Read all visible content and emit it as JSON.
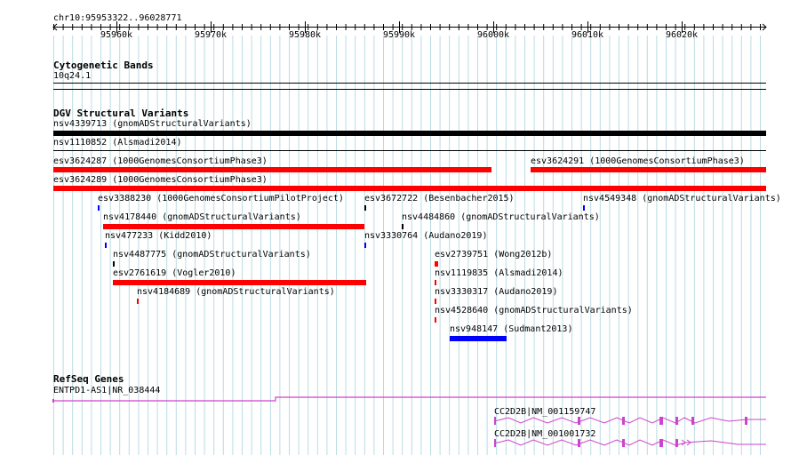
{
  "locus": "chr10:95953322..96028771",
  "ruler": {
    "ticks": [
      "95960k",
      "95970k",
      "95980k",
      "95990k",
      "96000k",
      "96010k",
      "96020k"
    ]
  },
  "colors": {
    "gridline": "#b9dce3",
    "gain": "#ff0000",
    "complex": "#000000",
    "loss": "#0000ff",
    "gene": "#cc44cc"
  },
  "tracks": {
    "cytoband": {
      "title": "Cytogenetic Bands",
      "band": "10q24.1"
    },
    "dgv": {
      "title": "DGV Structural Variants",
      "labels": {
        "nsv4339713": "nsv4339713 (gnomADStructuralVariants)",
        "nsv1110852": "nsv1110852 (Alsmadi2014)",
        "esv3624287": "esv3624287 (1000GenomesConsortiumPhase3)",
        "esv3624291": "esv3624291 (1000GenomesConsortiumPhase3)",
        "esv3624289": "esv3624289 (1000GenomesConsortiumPhase3)",
        "esv3388230": "esv3388230 (1000GenomesConsortiumPilotProject)",
        "esv3672722": "esv3672722 (Besenbacher2015)",
        "nsv4549348": "nsv4549348 (gnomADStructuralVariants)",
        "nsv4178440": "nsv4178440 (gnomADStructuralVariants)",
        "nsv4484860": "nsv4484860 (gnomADStructuralVariants)",
        "nsv477233": "nsv477233 (Kidd2010)",
        "nsv3330764": "nsv3330764 (Audano2019)",
        "nsv4487775": "nsv4487775 (gnomADStructuralVariants)",
        "esv2739751": "esv2739751 (Wong2012b)",
        "esv2761619": "esv2761619 (Vogler2010)",
        "nsv1119835": "nsv1119835 (Alsmadi2014)",
        "nsv4184689": "nsv4184689 (gnomADStructuralVariants)",
        "nsv3330317": "nsv3330317 (Audano2019)",
        "nsv4528640": "nsv4528640 (gnomADStructuralVariants)",
        "nsv948147": "nsv948147 (Sudmant2013)"
      }
    },
    "refseq": {
      "title": "RefSeq Genes",
      "labels": {
        "entpd1": "ENTPD1-AS1|NR_038444",
        "cc2d2b_1": "CC2D2B|NM_001159747",
        "cc2d2b_2": "CC2D2B|NM_001001732"
      }
    }
  }
}
